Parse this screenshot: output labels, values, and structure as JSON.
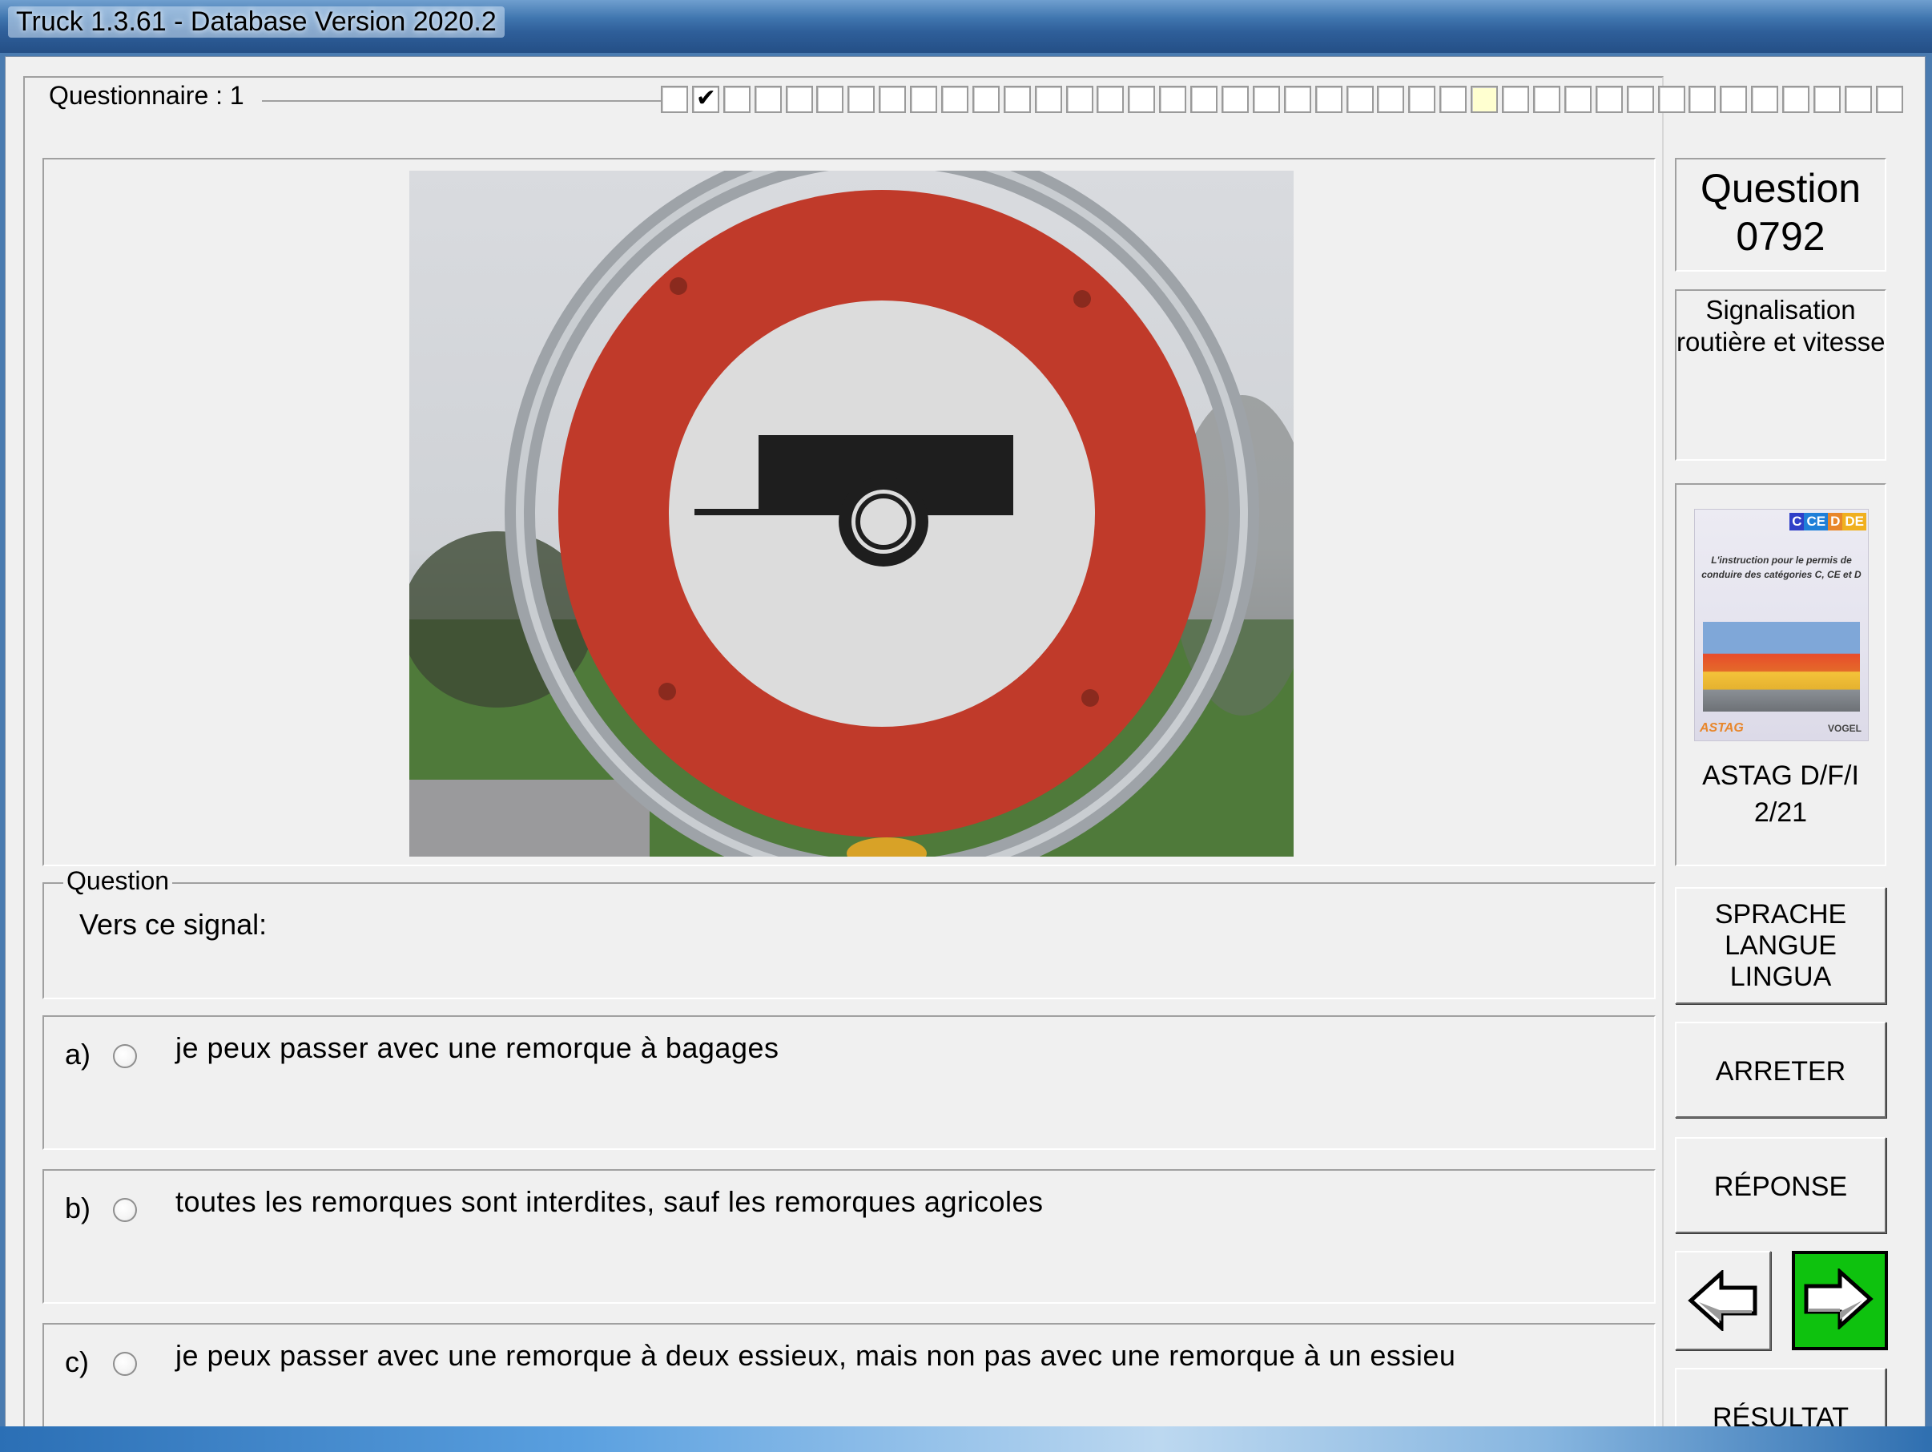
{
  "window": {
    "title": "Truck 1.3.61 - Database Version 2020.2"
  },
  "questionnaire": {
    "label": "Questionnaire : 1",
    "progress_boxes": 40,
    "checked_indices": [
      1
    ],
    "current_index": 26
  },
  "question": {
    "group_label": "Question",
    "text": "Vers ce signal:",
    "image_description_icon": "no-trailers-sign"
  },
  "answers": [
    {
      "letter": "a)",
      "text": "je peux passer avec une remorque à bagages"
    },
    {
      "letter": "b)",
      "text": "toutes les remorques sont interdites, sauf les remorques agricoles"
    },
    {
      "letter": "c)",
      "text": "je peux passer avec une remorque à deux essieux, mais non pas avec une remorque à un essieu"
    }
  ],
  "sidebar": {
    "question_label": "Question",
    "question_number": "0792",
    "category_line1": "Signalisation",
    "category_line2": "routière et vitesse",
    "book": {
      "tags": [
        "C",
        "CE",
        "D",
        "DE"
      ],
      "tag_colors": [
        "#2f3fc8",
        "#1f7fd8",
        "#e8862a",
        "#f0b020"
      ],
      "title": "L'instruction pour le permis de conduire des catégories C, CE et D",
      "logo_left": "ASTAG",
      "logo_right": "VOGEL",
      "caption_line1": "ASTAG D/F/I",
      "caption_line2": "2/21"
    },
    "language_button": [
      "SPRACHE",
      "LANGUE",
      "LINGUA"
    ],
    "stop_button": "ARRETER",
    "answer_button": "RÉPONSE",
    "prev_icon": "arrow-left-icon",
    "next_icon": "arrow-right-icon",
    "next_color": "#0ec20e",
    "result_button": "RÉSULTAT"
  }
}
